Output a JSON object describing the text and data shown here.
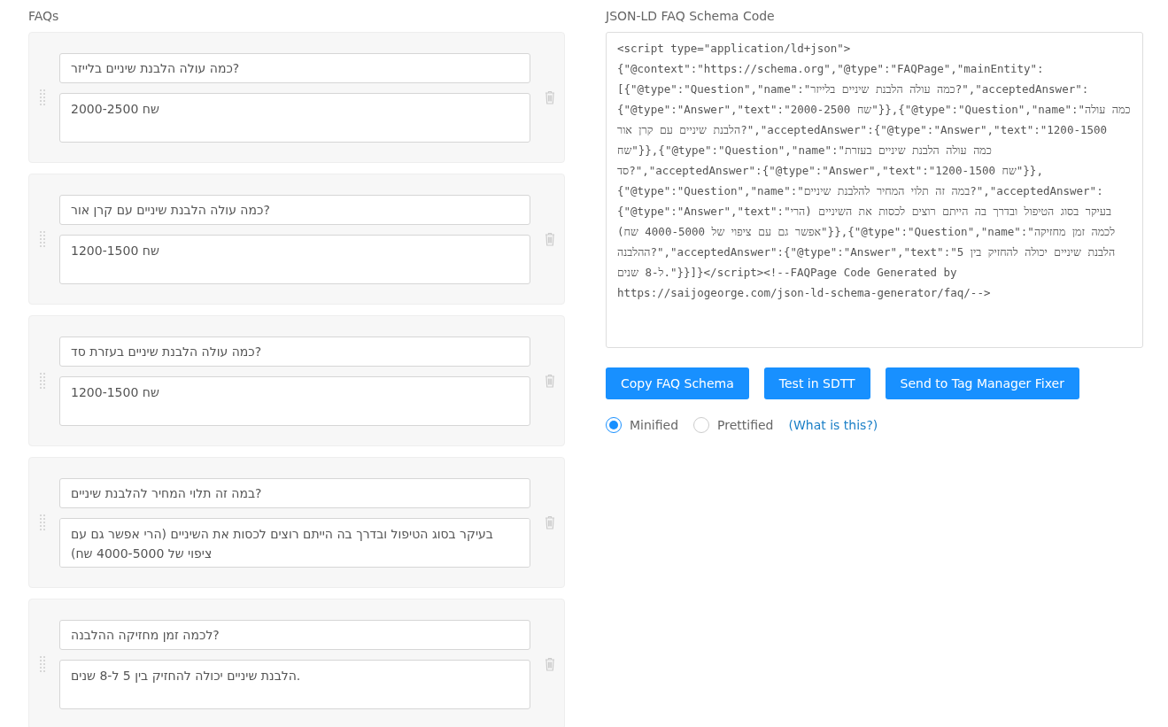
{
  "faqs_heading": "FAQs",
  "faqs": [
    {
      "question": "כמה עולה הלבנת שיניים בלייזר?",
      "answer": "2000-2500 שח"
    },
    {
      "question": "כמה עולה הלבנת שיניים עם קרן אור?",
      "answer": "1200-1500 שח"
    },
    {
      "question": "כמה עולה הלבנת שיניים בעזרת סד?",
      "answer": "1200-1500 שח"
    },
    {
      "question": "במה זה תלוי המחיר להלבנת שיניים?",
      "answer": "בעיקר בסוג הטיפול ובדרך בה הייתם רוצים לכסות את השיניים (הרי אפשר גם עם ציפוי של 4000-5000 שח)"
    },
    {
      "question": "לכמה זמן מחזיקה ההלבנה?",
      "answer": "הלבנת שיניים יכולה להחזיק בין 5 ל-8 שנים."
    }
  ],
  "schema_heading": "JSON-LD FAQ Schema Code",
  "code": "<script type=\"application/ld+json\">\n{\"@context\":\"https://schema.org\",\"@type\":\"FAQPage\",\"mainEntity\":[{\"@type\":\"Question\",\"name\":\"כמה עולה הלבנת שיניים בלייזר?\",\"acceptedAnswer\":{\"@type\":\"Answer\",\"text\":\"2000-2500 שח\"}},{\"@type\":\"Question\",\"name\":\"כמה עולה הלבנת שיניים עם קרן אור?\",\"acceptedAnswer\":{\"@type\":\"Answer\",\"text\":\"1200-1500 שח\"}},{\"@type\":\"Question\",\"name\":\"כמה עולה הלבנת שיניים בעזרת סד?\",\"acceptedAnswer\":{\"@type\":\"Answer\",\"text\":\"1200-1500 שח\"}},{\"@type\":\"Question\",\"name\":\"במה זה תלוי המחיר להלבנת שיניים?\",\"acceptedAnswer\":{\"@type\":\"Answer\",\"text\":\"בעיקר בסוג הטיפול ובדרך בה הייתם רוצים לכסות את השיניים (הרי אפשר גם עם ציפוי של 4000-5000 שח)\"}},{\"@type\":\"Question\",\"name\":\"לכמה זמן מחזיקה ההלבנה?\",\"acceptedAnswer\":{\"@type\":\"Answer\",\"text\":\"הלבנת שיניים יכולה להחזיק בין 5 ל-8 שנים.\"}}]}</script><!--FAQPage Code Generated by https://saijogeorge.com/json-ld-schema-generator/faq/-->",
  "copy_button": "Copy FAQ Schema",
  "test_button": "Test in SDTT",
  "send_button": "Send to Tag Manager Fixer",
  "minified_option": {
    "label": "Minified",
    "selected": true
  },
  "prettified_option": {
    "label": "Prettified",
    "selected": false
  },
  "help_link": "(What is this?)"
}
